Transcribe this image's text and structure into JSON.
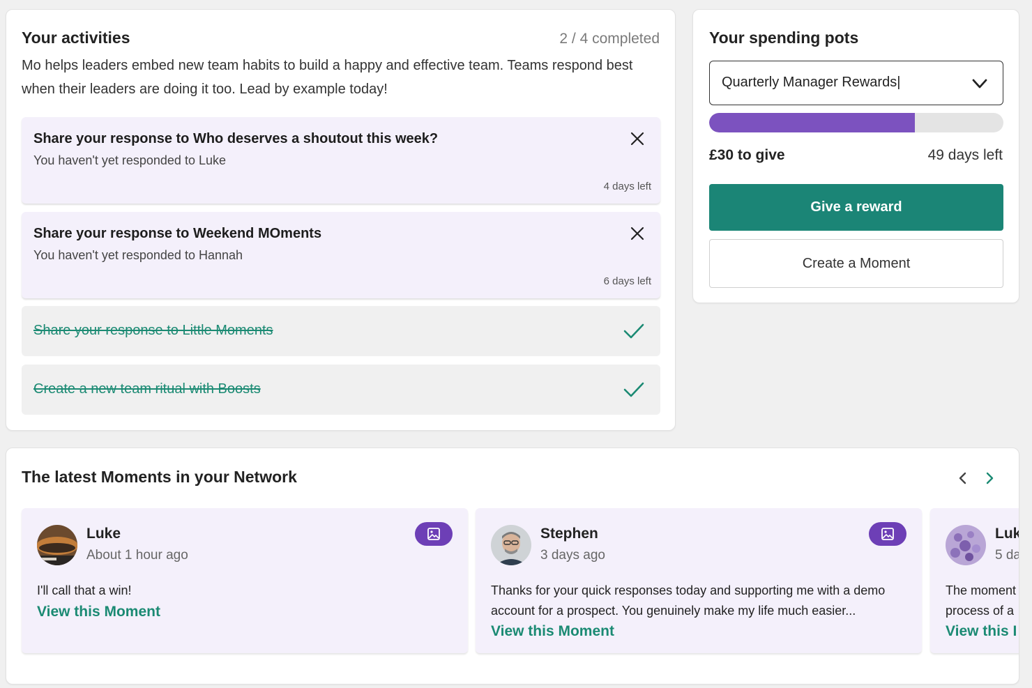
{
  "activities": {
    "title": "Your activities",
    "progress": "2 / 4 completed",
    "intro": "Mo helps leaders embed new team habits to build a happy and effective team. Teams respond best when their leaders are doing it too. Lead by example today!",
    "tasks": [
      {
        "title": "Share your response to Who deserves a shoutout this week?",
        "subtitle": "You haven't yet responded to Luke",
        "days_left": "4 days left",
        "status": "open",
        "icon": "close-icon"
      },
      {
        "title": "Share your response to Weekend MOments",
        "subtitle": "You haven't yet responded to Hannah",
        "days_left": "6 days left",
        "status": "open",
        "icon": "close-icon"
      },
      {
        "title": "Share your response to Little Moments",
        "status": "completed",
        "icon": "check-icon"
      },
      {
        "title": "Create a new team ritual with Boosts",
        "status": "completed",
        "icon": "check-icon"
      }
    ]
  },
  "pots": {
    "title": "Your spending pots",
    "selected_pot": "Quarterly Manager Rewards|",
    "progress_fraction": 0.7,
    "to_give": "£30 to give",
    "days_left": "49 days left",
    "primary_button": "Give a reward",
    "secondary_button": "Create a Moment"
  },
  "network": {
    "title": "The latest Moments in your Network",
    "moments": [
      {
        "author": "Luke",
        "time": "About 1 hour ago",
        "text": "I'll call that a win!",
        "link": "View this Moment",
        "badge_icon": "image-icon"
      },
      {
        "author": "Stephen",
        "time": "3 days ago",
        "text": "Thanks for your quick responses today and supporting me with a demo account for a prospect. You genuinely make my life much easier...",
        "link": "View this Moment",
        "badge_icon": "image-icon"
      },
      {
        "author": "Luk",
        "time": "5 da",
        "text": "The moment process of a",
        "link": "View this I",
        "badge_icon": ""
      }
    ]
  },
  "colors": {
    "brand_purple": "#7c52bf",
    "brand_teal": "#1b8576",
    "link_teal": "#1b8a73",
    "card_tint": "#f4f0fb"
  }
}
